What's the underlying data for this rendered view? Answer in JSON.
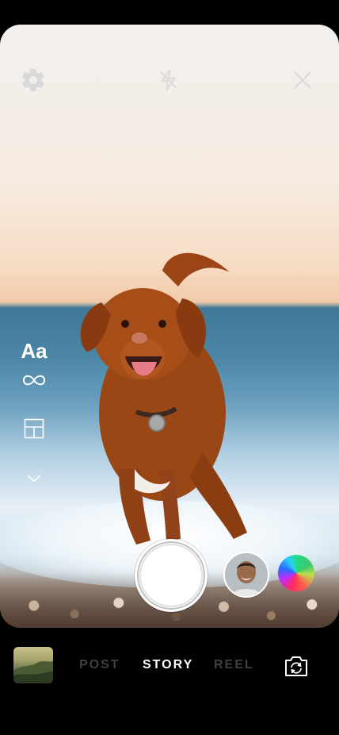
{
  "top_bar": {
    "settings_icon": "gear-icon",
    "flash_icon": "flash-off-icon",
    "close_icon": "close-icon"
  },
  "side_tools": {
    "text_label": "Aa",
    "boomerang_icon": "infinity-icon",
    "layout_icon": "layout-grid-icon",
    "more_icon": "chevron-down-icon"
  },
  "capture": {
    "shutter_icon": "shutter-button",
    "face_effect_icon": "face-effect-avatar",
    "color_effect_icon": "color-wheel-effect"
  },
  "modes": [
    "POST",
    "STORY",
    "REEL"
  ],
  "active_mode": "STORY",
  "bottom": {
    "gallery_icon": "gallery-thumbnail",
    "flip_camera_icon": "flip-camera-icon"
  },
  "colors": {
    "active_mode": "#ffffff",
    "inactive_mode": "#3f3f46",
    "background": "#000000"
  }
}
